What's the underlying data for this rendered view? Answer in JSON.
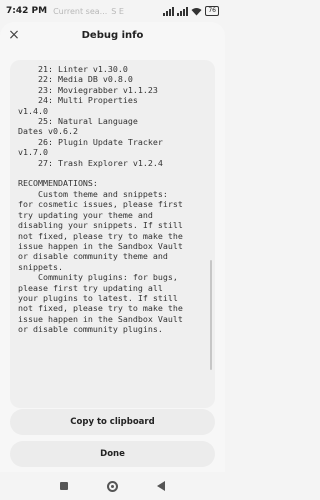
{
  "status_bar": {
    "time": "7:42 PM",
    "ghost_text": "Current sea...",
    "ghost_initials": "S E",
    "battery": "76"
  },
  "dialog": {
    "title": "Debug info",
    "close_glyph": "×",
    "debug_text": "    21: Linter v1.30.0\n    22: Media DB v0.8.0\n    23: Moviegrabber v1.1.23\n    24: Multi Properties\nv1.4.0\n    25: Natural Language\nDates v0.6.2\n    26: Plugin Update Tracker\nv1.7.0\n    27: Trash Explorer v1.2.4\n\nRECOMMENDATIONS:\n    Custom theme and snippets:\nfor cosmetic issues, please first\ntry updating your theme and\ndisabling your snippets. If still\nnot fixed, please try to make the\nissue happen in the Sandbox Vault\nor disable community theme and\nsnippets.\n    Community plugins: for bugs,\nplease first try updating all\nyour plugins to latest. If still\nnot fixed, please try to make the\nissue happen in the Sandbox Vault\nor disable community plugins.",
    "copy_label": "Copy to clipboard",
    "done_label": "Done"
  },
  "icons": {
    "close": "close-icon",
    "nav_recent": "square-icon",
    "nav_home": "circle-icon",
    "nav_back": "triangle-back-icon"
  }
}
